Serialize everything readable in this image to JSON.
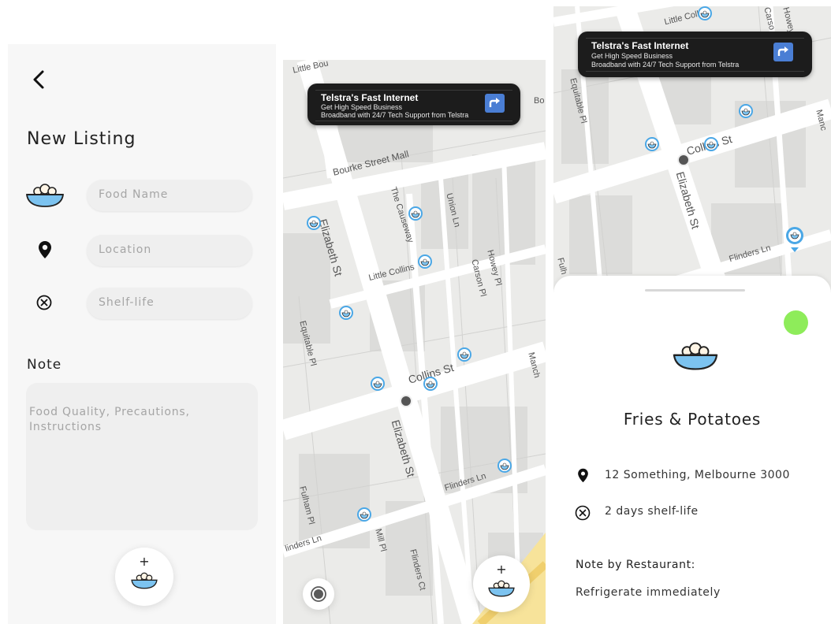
{
  "new_listing": {
    "back_icon": "chevron-left-icon",
    "title": "New Listing",
    "food_name_placeholder": "Food Name",
    "location_placeholder": "Location",
    "shelf_life_placeholder": "Shelf-life",
    "note_label": "Note",
    "note_placeholder": "Food Quality, Precautions, Instructions",
    "fab_plus": "+"
  },
  "map_view": {
    "ad": {
      "title": "Telstra's Fast Internet",
      "line1": "Get High Speed Business",
      "line2": "Broadband with 24/7 Tech Support from Telstra"
    },
    "streets": {
      "little_bourke": "Little Bou",
      "bourke_mall": "Bourke Street Mall",
      "elizabeth_top": "Elizabeth St",
      "gateway": "The Causeway",
      "union_ln": "Union Ln",
      "little_collins": "Little Collins",
      "howey_pl": "Howey Pl",
      "carson_pl": "Carson Pl",
      "equitable_pl": "Equitable Pl",
      "collins_st": "Collins St",
      "elizabeth_bottom": "Elizabeth St",
      "manchester": "Manch",
      "fulham_pl": "Fulham Pl",
      "flinders_ln": "Flinders Ln",
      "flinders_ln_left": "linders Ln",
      "mill_pl": "Mill Pl",
      "flinders_ct": "Flinders Ct",
      "bc": "Bo"
    },
    "fab_plus": "+"
  },
  "detail_view": {
    "ad": {
      "title": "Telstra's Fast Internet",
      "line1": "Get High Speed Business",
      "line2": "Broadband with 24/7 Tech Support from Telstra"
    },
    "streets": {
      "little_collins": "Little Collin",
      "equitable_pl": "Equitable Pl",
      "collins_st": "Collins St",
      "elizabeth_st": "Elizabeth St",
      "flinders_ln": "Flinders Ln",
      "fulham": "Fulh",
      "carson": "Carso",
      "howey": "Howey",
      "manc": "Manc"
    },
    "food_title": "Fries & Potatoes",
    "address": "12 Something, Melbourne 3000",
    "shelf_life": "2 days shelf-life",
    "note_heading": "Note by Restaurant:",
    "note_text": "Refrigerate immediately",
    "status_color": "#8eec5a"
  },
  "colors": {
    "pin_blue": "#4aa7e6",
    "bowl_blue": "#7cc3f0",
    "map_bg": "#ebebe9",
    "ad_button": "#4a7ed4"
  }
}
